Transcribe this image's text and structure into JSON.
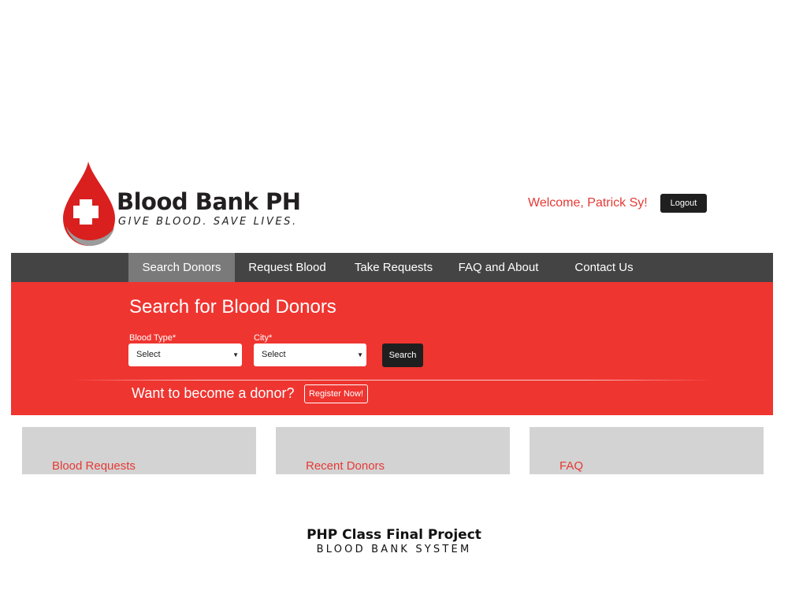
{
  "header": {
    "brand_name": "Blood Bank PH",
    "tagline": "GIVE BLOOD. SAVE LIVES.",
    "welcome_text": "Welcome, Patrick Sy!",
    "logout_label": "Logout"
  },
  "nav": {
    "items": [
      {
        "label": "Search Donors",
        "active": true
      },
      {
        "label": "Request Blood",
        "active": false
      },
      {
        "label": "Take Requests",
        "active": false
      },
      {
        "label": "FAQ and About",
        "active": false
      },
      {
        "label": "Contact Us",
        "active": false
      }
    ]
  },
  "search": {
    "title": "Search for Blood Donors",
    "blood_type_label": "Blood Type*",
    "blood_type_value": "Select",
    "city_label": "City*",
    "city_value": "Select",
    "search_label": "Search"
  },
  "donor_cta": {
    "question": "Want to become a donor?",
    "register_label": "Register Now!"
  },
  "panels": [
    {
      "title": "Blood Requests"
    },
    {
      "title": "Recent Donors"
    },
    {
      "title": "FAQ"
    }
  ],
  "footer": {
    "title": "PHP Class Final Project",
    "subtitle": "BLOOD BANK SYSTEM"
  },
  "colors": {
    "accent_red": "#ef3530",
    "nav_bg": "#444444",
    "nav_active": "#7a7a7a",
    "panel_bg": "#d3d3d3",
    "button_dark": "#1f1f1f"
  }
}
